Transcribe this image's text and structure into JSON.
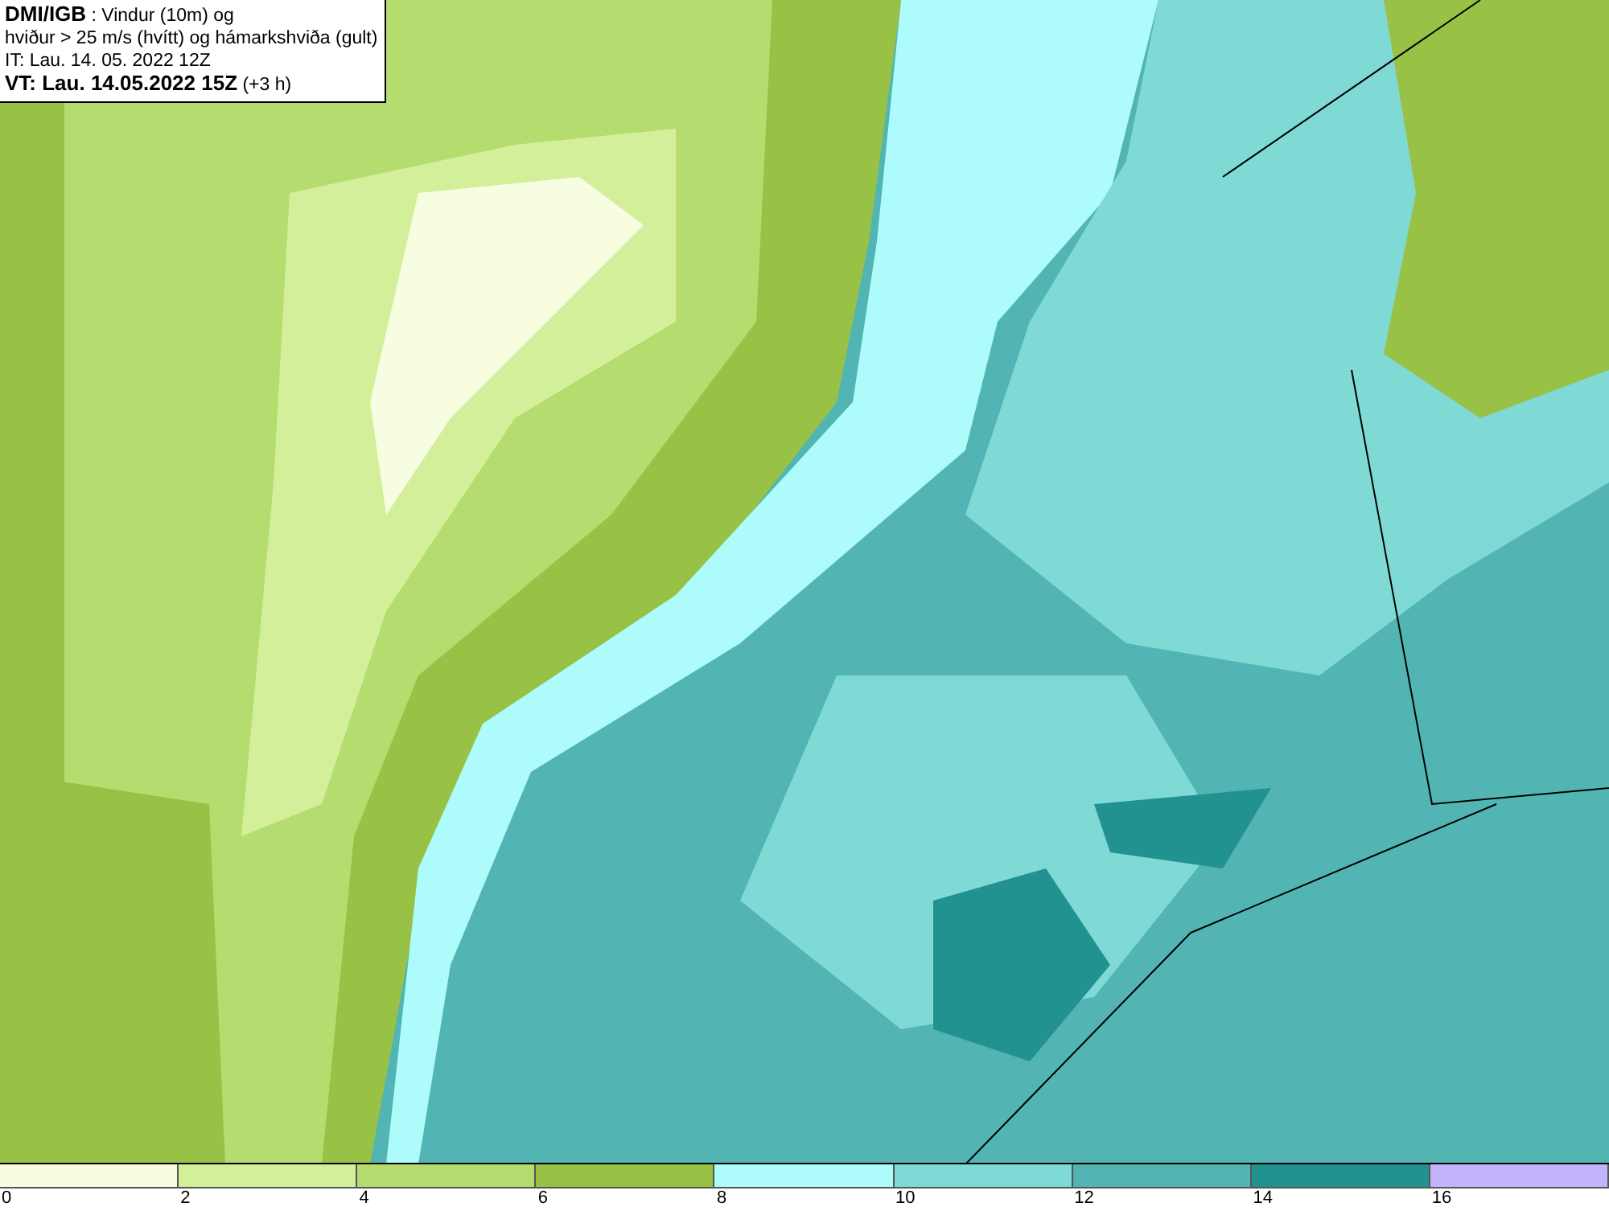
{
  "header": {
    "lines": [
      "**DMI/IGB** : Vindur (10m) og",
      "hviður > 25 m/s (hvítt) og hámarkshviða (gult)",
      "IT: Lau. 14. 05. 2022 12Z",
      "**VT: Lau. 14.05.2022 15Z** (+3 h)"
    ]
  },
  "legend": [
    {
      "color": "#f7fde0",
      "label": "0"
    },
    {
      "color": "#d4ef9a",
      "label": "2"
    },
    {
      "color": "#b5dc6f",
      "label": "4"
    },
    {
      "color": "#98c245",
      "label": "6"
    },
    {
      "color": "#aefbfb",
      "label": "8"
    },
    {
      "color": "#7fdad6",
      "label": "10"
    },
    {
      "color": "#52b5b3",
      "label": "12"
    },
    {
      "color": "#229290",
      "label": "14"
    },
    {
      "color": "#c3b3fa",
      "label": "16"
    }
  ]
}
